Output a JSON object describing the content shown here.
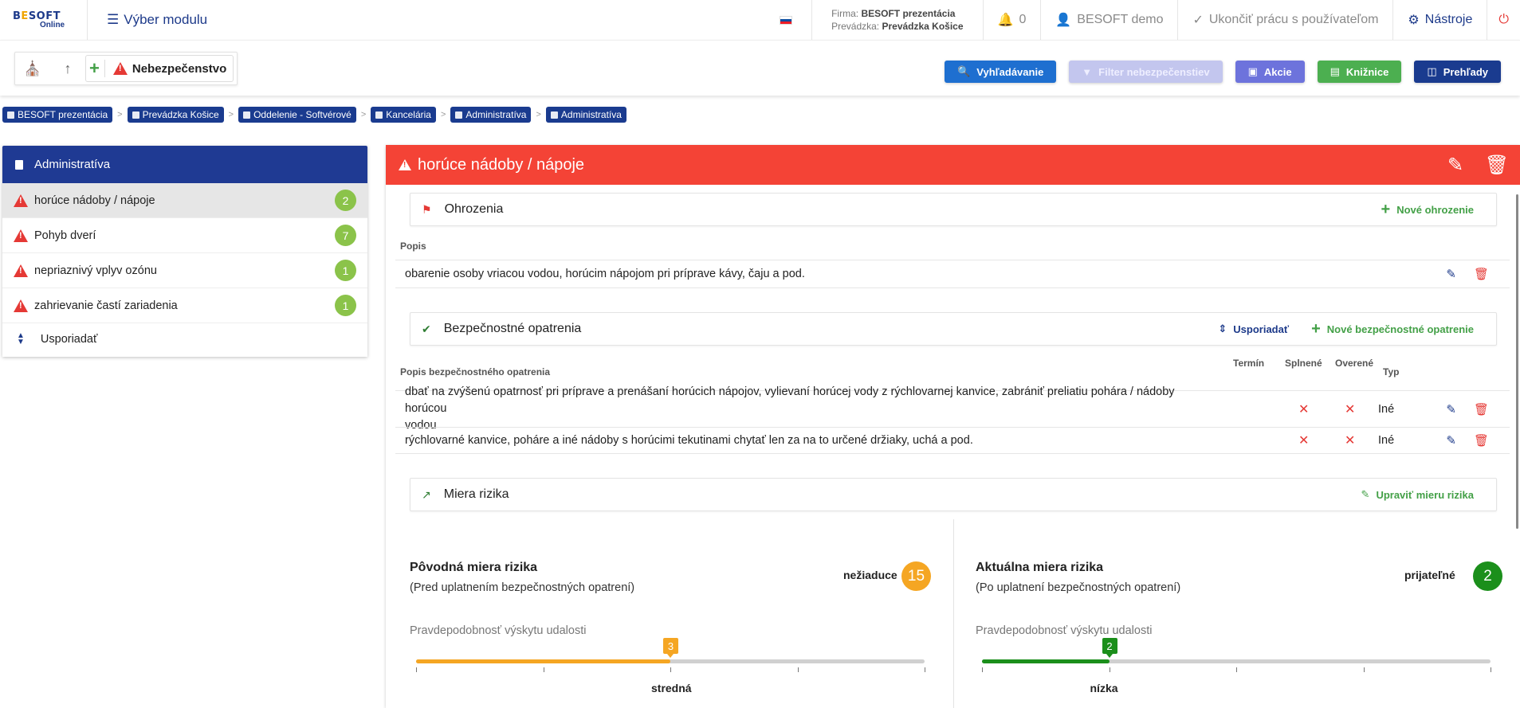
{
  "topbar": {
    "logo_main": "BESOFT",
    "logo_sub": "Online",
    "module_label": "Výber modulu",
    "firm_label": "Firma:",
    "firm_value": "BESOFT prezentácia",
    "unit_label": "Prevádzka:",
    "unit_value": "Prevádzka Košice",
    "notifications": "0",
    "user": "BESOFT demo",
    "end_work": "Ukončiť prácu s používateľom",
    "tools": "Nástroje"
  },
  "toolbar": {
    "item_label": "Nebezpečenstvo",
    "buttons": {
      "search": "Vyhľadávanie",
      "filter": "Filter nebezpečenstiev",
      "akcie": "Akcie",
      "kniznice": "Knižnice",
      "prehlady": "Prehľady"
    }
  },
  "breadcrumb": [
    "BESOFT prezentácia",
    "Prevádzka Košice",
    "Oddelenie - Softvérové",
    "Kancelária",
    "Administratíva",
    "Administratíva"
  ],
  "left_panel": {
    "title": "Administratíva",
    "items": [
      {
        "label": "horúce nádoby / nápoje",
        "count": "2"
      },
      {
        "label": "Pohyb dverí",
        "count": "7"
      },
      {
        "label": "nepriaznivý vplyv ozónu",
        "count": "1"
      },
      {
        "label": "zahrievanie častí zariadenia",
        "count": "1"
      }
    ],
    "sort_label": "Usporiadať"
  },
  "main": {
    "title": "horúce nádoby / nápoje",
    "threats": {
      "title": "Ohrozenia",
      "new_label": "Nové ohrozenie",
      "col_desc": "Popis",
      "rows": [
        "obarenie osoby vriacou vodou, horúcim nápojom pri príprave kávy, čaju a pod."
      ]
    },
    "measures": {
      "title": "Bezpečnostné opatrenia",
      "sort_label": "Usporiadať",
      "new_label": "Nové bezpečnostné opatrenie",
      "col_desc": "Popis bezpečnostného opatrenia",
      "col_term": "Termín",
      "col_done": "Splnené",
      "col_verified": "Overené",
      "col_type": "Typ",
      "rows": [
        {
          "desc_line1": "dbať na zvýšenú opatrnosť pri príprave a prenášaní horúcich nápojov, vylievaní horúcej vody z rýchlovarnej kanvice, zabrániť preliatiu pohára / nádoby horúcou",
          "desc_line2": "vodou",
          "type": "Iné"
        },
        {
          "desc_line1": "rýchlovarné kanvice, poháre a iné nádoby s horúcimi tekutinami chytať len za na to určené držiaky, uchá a pod.",
          "desc_line2": "",
          "type": "Iné"
        }
      ]
    },
    "risk": {
      "title": "Miera rizika",
      "edit_label": "Upraviť mieru rizika",
      "original": {
        "title": "Pôvodná miera rizika",
        "subtitle": "(Pred uplatnením bezpečnostných opatrení)",
        "level": "nežiaduce",
        "score": "15",
        "color": "#f5a623",
        "prob_label": "Pravdepodobnosť výskytu udalosti",
        "prob_value": "3",
        "prob_fraction": 0.5,
        "prob_text": "stredná"
      },
      "current": {
        "title": "Aktuálna miera rizika",
        "subtitle": "(Po uplatnení bezpečnostných opatrení)",
        "level": "prijateľné",
        "score": "2",
        "color": "#1b8f1b",
        "prob_label": "Pravdepodobnosť výskytu udalosti",
        "prob_value": "2",
        "prob_fraction": 0.25,
        "prob_text": "nízka"
      }
    }
  }
}
